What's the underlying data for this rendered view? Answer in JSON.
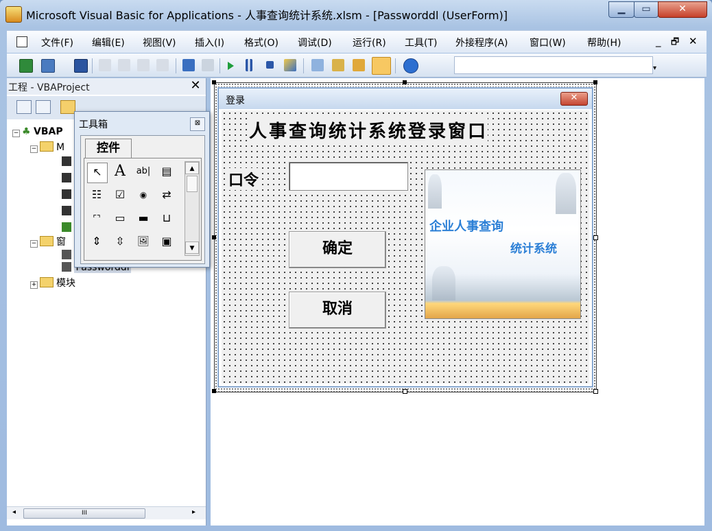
{
  "window": {
    "title": "Microsoft Visual Basic for Applications - 人事查询统计系统.xlsm - [Passworddl (UserForm)]",
    "min_glyph": "▁",
    "max_glyph": "▭",
    "close_glyph": "✕"
  },
  "menubar": {
    "items": [
      "文件(F)",
      "编辑(E)",
      "视图(V)",
      "插入(I)",
      "格式(O)",
      "调试(D)",
      "运行(R)",
      "工具(T)",
      "外接程序(A)",
      "窗口(W)",
      "帮助(H)"
    ],
    "mdi_min": "_",
    "mdi_restore": "🗗",
    "mdi_close": "✕"
  },
  "toolbar": {
    "icons": [
      "excel-icon",
      "insert-userform-icon",
      "save-icon",
      "cut-icon",
      "copy-icon",
      "paste-icon",
      "find-icon",
      "undo-icon",
      "redo-icon",
      "run-icon",
      "break-icon",
      "reset-icon",
      "design-mode-icon",
      "project-explorer-icon",
      "properties-icon",
      "object-browser-icon",
      "toolbox-icon",
      "help-icon"
    ]
  },
  "project": {
    "title": "工程 - VBAProject",
    "close": "✕",
    "tree": {
      "root": "VBAP",
      "folder_m": "M",
      "folder_forms": "窗",
      "form_item": "Passworddl",
      "modules": "模块"
    },
    "scroll_grip": "III"
  },
  "toolbox": {
    "title": "工具箱",
    "close": "⊠",
    "tab": "控件",
    "tools": [
      "↖",
      "A",
      "ab|",
      "▤",
      "☷",
      "☑",
      "◉",
      "⇄",
      "⌜⌝",
      "▭",
      "▬",
      "⊔",
      "⇕",
      "⇳",
      "🖼",
      "▣"
    ]
  },
  "form": {
    "title": "登录",
    "close": "✕",
    "heading": "人事查询统计系统登录窗口",
    "password_label": "口令",
    "password_value": "",
    "ok_label": "确定",
    "cancel_label": "取消",
    "picture_line1": "企业人事查询",
    "picture_line2": "统计系统"
  }
}
